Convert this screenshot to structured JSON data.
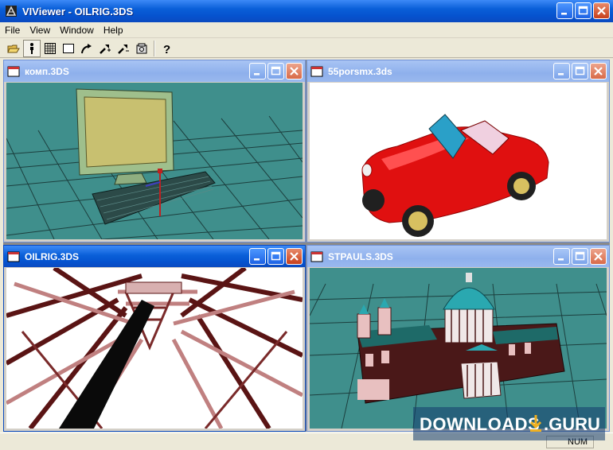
{
  "app": {
    "title": "VIViewer - OILRIG.3DS"
  },
  "menu": {
    "items": [
      "File",
      "View",
      "Window",
      "Help"
    ]
  },
  "toolbar": {
    "buttons": [
      "open-icon",
      "walk-icon",
      "grid-icon",
      "select-box-icon",
      "rotate-arrow-icon",
      "zoom-in-icon",
      "zoom-out-icon",
      "camera-icon",
      "help-icon"
    ],
    "pressed": "walk-icon"
  },
  "windows": [
    {
      "title": "комп.3DS",
      "active": false,
      "scene": "computer"
    },
    {
      "title": "55porsmx.3ds",
      "active": false,
      "scene": "car"
    },
    {
      "title": "OILRIG.3DS",
      "active": true,
      "scene": "oilrig"
    },
    {
      "title": "STPAULS.3DS",
      "active": false,
      "scene": "cathedral"
    }
  ],
  "status": {
    "num_indicator": "NUM"
  },
  "watermark": {
    "text": "DOWNLOADS",
    "suffix": ".GURU"
  },
  "colors": {
    "teal_bg": "#3f8f8c",
    "title_active": "#0a5fd8",
    "title_inactive": "#8eb0ec"
  }
}
